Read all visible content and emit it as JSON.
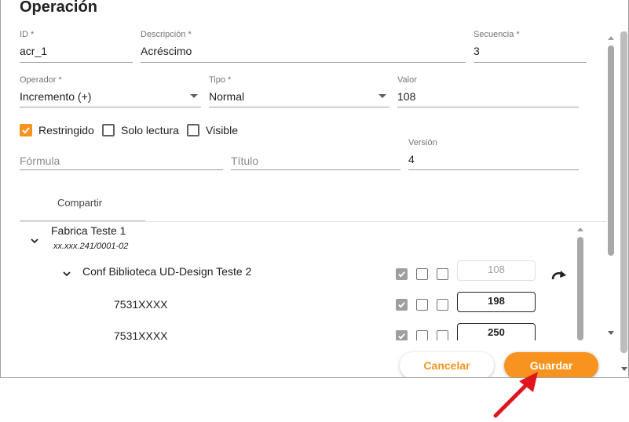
{
  "dialog": {
    "title": "Operación"
  },
  "fields": {
    "id": {
      "label": "ID *",
      "value": "acr_1"
    },
    "descripcion": {
      "label": "Descripción *",
      "value": "Acréscimo"
    },
    "secuencia": {
      "label": "Secuencia *",
      "value": "3"
    },
    "operador": {
      "label": "Operador *",
      "value": "Incremento (+)"
    },
    "tipo": {
      "label": "Tipo *",
      "value": "Normal"
    },
    "valor": {
      "label": "Valor",
      "value": "108"
    },
    "formula": {
      "placeholder": "Fórmula"
    },
    "titulo": {
      "placeholder": "Título"
    },
    "version": {
      "label": "Versión",
      "value": "4"
    }
  },
  "checkboxes": {
    "restringido": {
      "label": "Restringido",
      "checked": true
    },
    "solo_lectura": {
      "label": "Solo lectura",
      "checked": false
    },
    "visible": {
      "label": "Visible",
      "checked": false
    }
  },
  "tabs": [
    {
      "label": "Compartir",
      "active": true
    }
  ],
  "tree": {
    "company": {
      "name": "Fabrica Teste 1",
      "cnpj": "xx.xxx.241/0001-02"
    },
    "config": {
      "name": "Conf Biblioteca UD-Design Teste 2",
      "value": "108"
    },
    "items": [
      {
        "code": "7531XXXX",
        "value": "198"
      },
      {
        "code": "7531XXXX",
        "value": "250"
      }
    ]
  },
  "actions": {
    "cancel_label": "Cancelar",
    "save_label": "Guardar"
  },
  "colors": {
    "accent": "#f7931e",
    "annotation_arrow": "#e0161f"
  },
  "icons": [
    "chevron-down-icon",
    "check-icon",
    "redo-icon",
    "dropdown-caret-icon"
  ]
}
